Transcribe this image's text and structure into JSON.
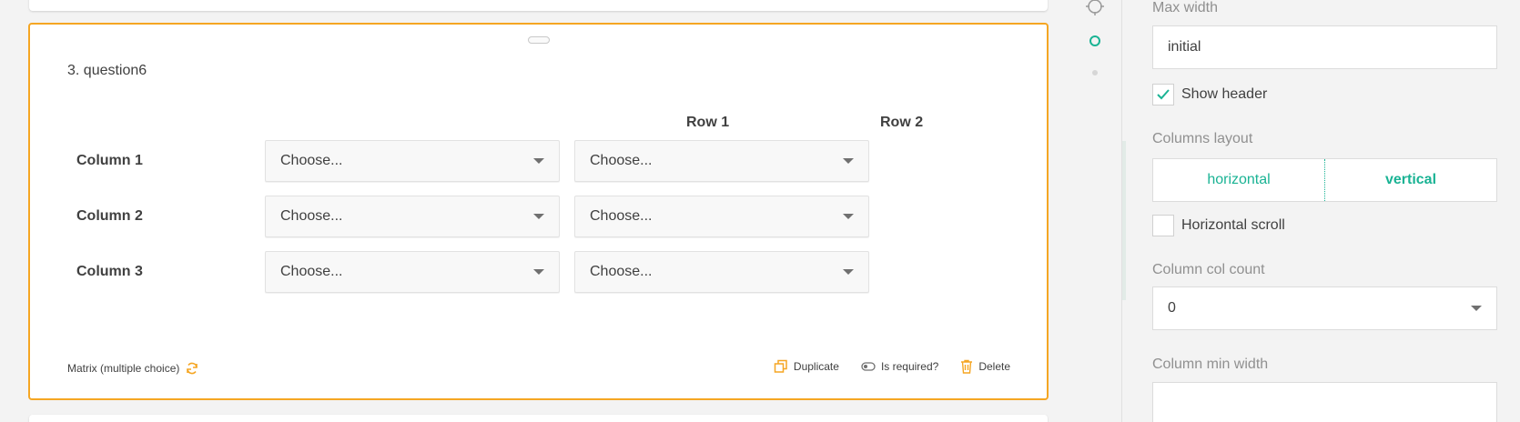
{
  "question": {
    "title": "3. question6",
    "rows": [
      "Row 1",
      "Row 2"
    ],
    "columns": [
      "Column 1",
      "Column 2",
      "Column 3"
    ],
    "cell_placeholder": "Choose...",
    "type_label": "Matrix (multiple choice)",
    "actions": {
      "duplicate": "Duplicate",
      "required": "Is required?",
      "delete": "Delete"
    }
  },
  "properties": {
    "max_width": {
      "label": "Max width",
      "value": "initial"
    },
    "show_header": {
      "label": "Show header",
      "checked": true
    },
    "columns_layout": {
      "label": "Columns layout",
      "options": [
        "horizontal",
        "vertical"
      ],
      "selected": "vertical"
    },
    "horizontal_scroll": {
      "label": "Horizontal scroll",
      "checked": false
    },
    "column_col_count": {
      "label": "Column col count",
      "value": "0"
    },
    "column_min_width": {
      "label": "Column min width",
      "value": ""
    }
  },
  "colors": {
    "accent": "#1ab394",
    "selected_border": "#f5a623",
    "icon_orange": "#f5a623"
  },
  "icons": {
    "drag": "drag-handle-icon",
    "change_type": "refresh-icon",
    "duplicate": "copy-icon",
    "required": "toggle-icon",
    "delete": "trash-icon",
    "toolbox": "target-icon",
    "status": "circle-icon",
    "dot": "dot-icon",
    "dropdown": "chevron-down-icon",
    "check": "check-icon"
  }
}
